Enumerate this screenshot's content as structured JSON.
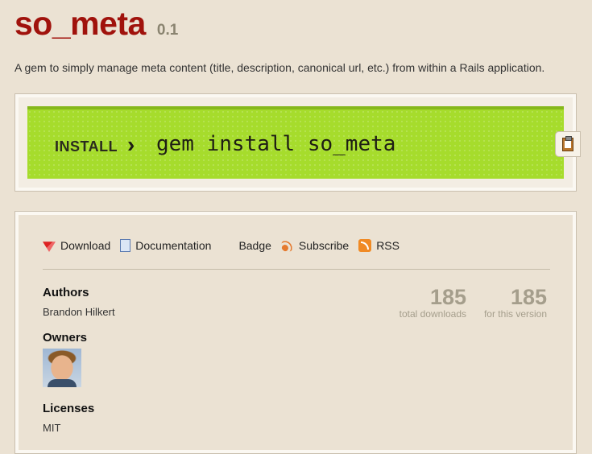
{
  "gem": {
    "name": "so_meta",
    "version": "0.1",
    "description": "A gem to simply manage meta content (title, description, canonical url, etc.) from within a Rails application."
  },
  "install": {
    "label": "INSTALL",
    "chevron": "›",
    "command": "gem install so_meta"
  },
  "links": {
    "download": "Download",
    "documentation": "Documentation",
    "badge": "Badge",
    "subscribe": "Subscribe",
    "rss": "RSS"
  },
  "sections": {
    "authors_title": "Authors",
    "authors": "Brandon Hilkert",
    "owners_title": "Owners",
    "licenses_title": "Licenses",
    "licenses": "MIT"
  },
  "stats": {
    "total_downloads": "185",
    "total_downloads_label": "total downloads",
    "version_downloads": "185",
    "version_downloads_label": "for this version"
  },
  "colors": {
    "title": "#a0120c",
    "install_bar": "#a6dc2c",
    "background": "#ebe2d3"
  }
}
